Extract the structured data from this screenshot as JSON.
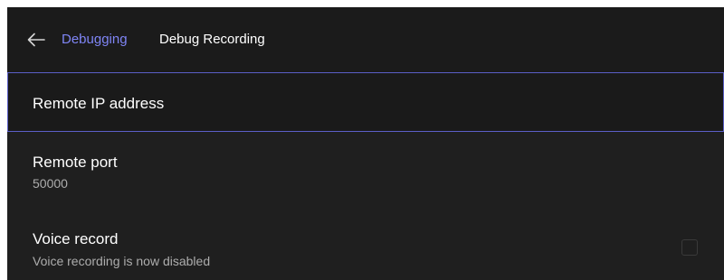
{
  "header": {
    "back_icon": "arrow-left-icon",
    "parent_label": "Debugging",
    "current_label": "Debug Recording",
    "accent_color": "#7f85f5"
  },
  "settings": {
    "remote_ip": {
      "label": "Remote IP address",
      "value": ""
    },
    "remote_port": {
      "label": "Remote port",
      "value": "50000"
    },
    "voice_record": {
      "label": "Voice record",
      "status": "Voice recording is now disabled",
      "checked": false
    }
  },
  "colors": {
    "background": "#1f1f1f",
    "header_background": "#1b1b1b",
    "focus_border": "#5b5fc7",
    "primary_text": "#ffffff",
    "secondary_text": "#adadad"
  }
}
